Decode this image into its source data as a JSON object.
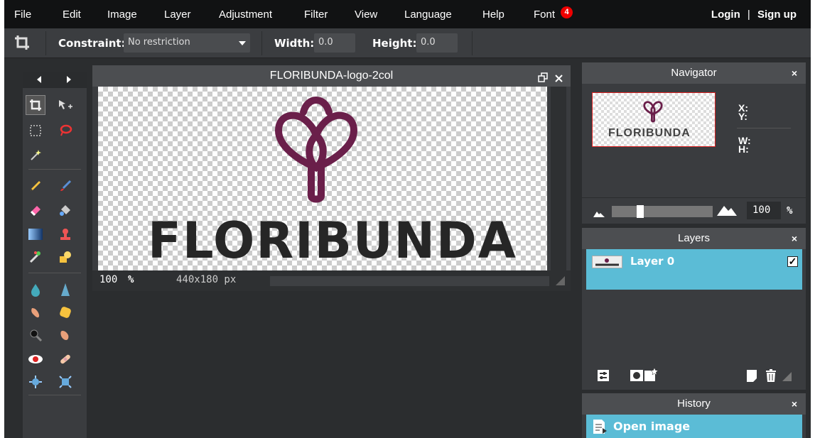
{
  "menu": {
    "items": [
      "File",
      "Edit",
      "Image",
      "Layer",
      "Adjustment",
      "Filter",
      "View",
      "Language",
      "Help",
      "Font"
    ],
    "font_badge": "4",
    "login": "Login",
    "separator": "|",
    "signup": "Sign up"
  },
  "toolbar": {
    "constraint_label": "Constraint:",
    "constraint_value": "No restriction",
    "width_label": "Width:",
    "width_value": "0.0",
    "height_label": "Height:",
    "height_value": "0.0"
  },
  "document": {
    "title": "FLORIBUNDA-logo-2col",
    "zoom_value": "100",
    "zoom_unit": "%",
    "dimensions": "440x180 px",
    "logo_text": "FLORIBUNDA"
  },
  "navigator": {
    "title": "Navigator",
    "close": "×",
    "thumb_text": "FLORIBUNDA",
    "x_label": "X:",
    "y_label": "Y:",
    "w_label": "W:",
    "h_label": "H:",
    "zoom_value": "100",
    "zoom_unit": "%"
  },
  "layers": {
    "title": "Layers",
    "close": "×",
    "items": [
      {
        "name": "Layer 0",
        "visible": true
      }
    ]
  },
  "history": {
    "title": "History",
    "close": "×",
    "items": [
      {
        "label": "Open image"
      }
    ]
  },
  "colors": {
    "accent": "#5bbcd6",
    "logo_mark": "#6a1f4a",
    "badge": "#e00000"
  }
}
